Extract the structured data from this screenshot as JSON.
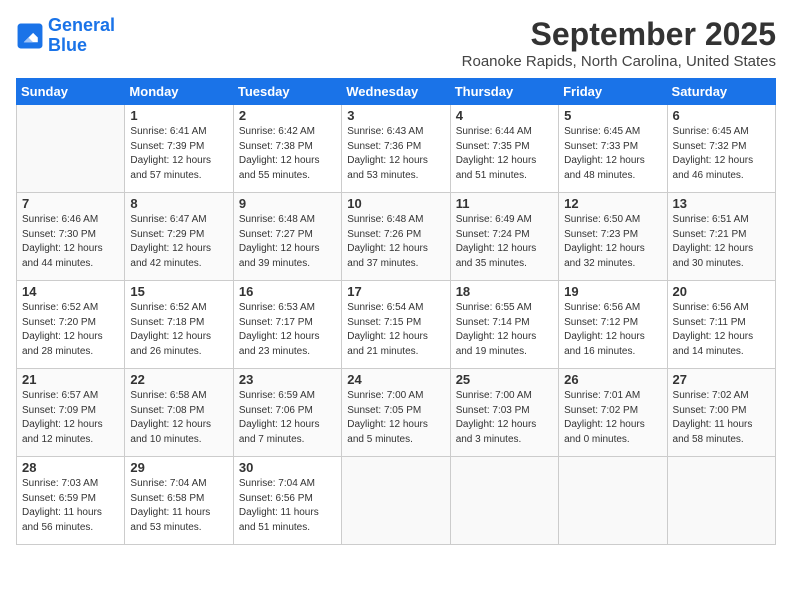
{
  "header": {
    "logo_line1": "General",
    "logo_line2": "Blue",
    "month": "September 2025",
    "location": "Roanoke Rapids, North Carolina, United States"
  },
  "weekdays": [
    "Sunday",
    "Monday",
    "Tuesday",
    "Wednesday",
    "Thursday",
    "Friday",
    "Saturday"
  ],
  "weeks": [
    [
      {
        "day": "",
        "info": ""
      },
      {
        "day": "1",
        "info": "Sunrise: 6:41 AM\nSunset: 7:39 PM\nDaylight: 12 hours\nand 57 minutes."
      },
      {
        "day": "2",
        "info": "Sunrise: 6:42 AM\nSunset: 7:38 PM\nDaylight: 12 hours\nand 55 minutes."
      },
      {
        "day": "3",
        "info": "Sunrise: 6:43 AM\nSunset: 7:36 PM\nDaylight: 12 hours\nand 53 minutes."
      },
      {
        "day": "4",
        "info": "Sunrise: 6:44 AM\nSunset: 7:35 PM\nDaylight: 12 hours\nand 51 minutes."
      },
      {
        "day": "5",
        "info": "Sunrise: 6:45 AM\nSunset: 7:33 PM\nDaylight: 12 hours\nand 48 minutes."
      },
      {
        "day": "6",
        "info": "Sunrise: 6:45 AM\nSunset: 7:32 PM\nDaylight: 12 hours\nand 46 minutes."
      }
    ],
    [
      {
        "day": "7",
        "info": "Sunrise: 6:46 AM\nSunset: 7:30 PM\nDaylight: 12 hours\nand 44 minutes."
      },
      {
        "day": "8",
        "info": "Sunrise: 6:47 AM\nSunset: 7:29 PM\nDaylight: 12 hours\nand 42 minutes."
      },
      {
        "day": "9",
        "info": "Sunrise: 6:48 AM\nSunset: 7:27 PM\nDaylight: 12 hours\nand 39 minutes."
      },
      {
        "day": "10",
        "info": "Sunrise: 6:48 AM\nSunset: 7:26 PM\nDaylight: 12 hours\nand 37 minutes."
      },
      {
        "day": "11",
        "info": "Sunrise: 6:49 AM\nSunset: 7:24 PM\nDaylight: 12 hours\nand 35 minutes."
      },
      {
        "day": "12",
        "info": "Sunrise: 6:50 AM\nSunset: 7:23 PM\nDaylight: 12 hours\nand 32 minutes."
      },
      {
        "day": "13",
        "info": "Sunrise: 6:51 AM\nSunset: 7:21 PM\nDaylight: 12 hours\nand 30 minutes."
      }
    ],
    [
      {
        "day": "14",
        "info": "Sunrise: 6:52 AM\nSunset: 7:20 PM\nDaylight: 12 hours\nand 28 minutes."
      },
      {
        "day": "15",
        "info": "Sunrise: 6:52 AM\nSunset: 7:18 PM\nDaylight: 12 hours\nand 26 minutes."
      },
      {
        "day": "16",
        "info": "Sunrise: 6:53 AM\nSunset: 7:17 PM\nDaylight: 12 hours\nand 23 minutes."
      },
      {
        "day": "17",
        "info": "Sunrise: 6:54 AM\nSunset: 7:15 PM\nDaylight: 12 hours\nand 21 minutes."
      },
      {
        "day": "18",
        "info": "Sunrise: 6:55 AM\nSunset: 7:14 PM\nDaylight: 12 hours\nand 19 minutes."
      },
      {
        "day": "19",
        "info": "Sunrise: 6:56 AM\nSunset: 7:12 PM\nDaylight: 12 hours\nand 16 minutes."
      },
      {
        "day": "20",
        "info": "Sunrise: 6:56 AM\nSunset: 7:11 PM\nDaylight: 12 hours\nand 14 minutes."
      }
    ],
    [
      {
        "day": "21",
        "info": "Sunrise: 6:57 AM\nSunset: 7:09 PM\nDaylight: 12 hours\nand 12 minutes."
      },
      {
        "day": "22",
        "info": "Sunrise: 6:58 AM\nSunset: 7:08 PM\nDaylight: 12 hours\nand 10 minutes."
      },
      {
        "day": "23",
        "info": "Sunrise: 6:59 AM\nSunset: 7:06 PM\nDaylight: 12 hours\nand 7 minutes."
      },
      {
        "day": "24",
        "info": "Sunrise: 7:00 AM\nSunset: 7:05 PM\nDaylight: 12 hours\nand 5 minutes."
      },
      {
        "day": "25",
        "info": "Sunrise: 7:00 AM\nSunset: 7:03 PM\nDaylight: 12 hours\nand 3 minutes."
      },
      {
        "day": "26",
        "info": "Sunrise: 7:01 AM\nSunset: 7:02 PM\nDaylight: 12 hours\nand 0 minutes."
      },
      {
        "day": "27",
        "info": "Sunrise: 7:02 AM\nSunset: 7:00 PM\nDaylight: 11 hours\nand 58 minutes."
      }
    ],
    [
      {
        "day": "28",
        "info": "Sunrise: 7:03 AM\nSunset: 6:59 PM\nDaylight: 11 hours\nand 56 minutes."
      },
      {
        "day": "29",
        "info": "Sunrise: 7:04 AM\nSunset: 6:58 PM\nDaylight: 11 hours\nand 53 minutes."
      },
      {
        "day": "30",
        "info": "Sunrise: 7:04 AM\nSunset: 6:56 PM\nDaylight: 11 hours\nand 51 minutes."
      },
      {
        "day": "",
        "info": ""
      },
      {
        "day": "",
        "info": ""
      },
      {
        "day": "",
        "info": ""
      },
      {
        "day": "",
        "info": ""
      }
    ]
  ]
}
